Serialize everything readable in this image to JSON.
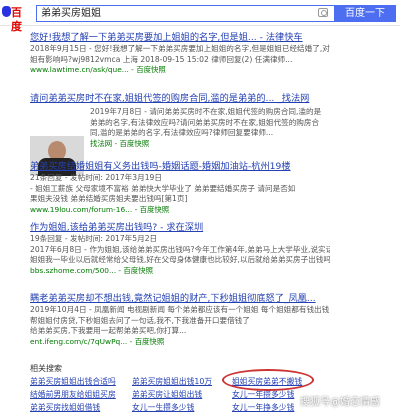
{
  "header": {
    "logo_text": "百度",
    "query": "弟弟买房姐姐",
    "search_button": "百度一下"
  },
  "results": [
    {
      "title": "您好!我想了解一下弟弟买房要加上姐姐的名字,但是姐... - 法律快车",
      "lines": [
        "2018年9月15日 - 您好!我想了解一下弟弟买房要加上姐姐的名字,但是姐姐已经结婚了,对姐",
        "姐有影响吗?wj9812vmca 上海 2018-09-15 15:02 律师回复(2) 任满律师..."
      ],
      "url": "www.lawtime.cn/ask/que... - 百度快照"
    },
    {
      "title": "请问弟弟买房时不在家,姐姐代签的购房合同,滥的是弟弟的... _找法网",
      "lines": [
        "2019年7月8日 - 请问弟弟买房时不在家,姐姐代签的购房合同,滥的是",
        "弟弟的名字,有法律效应吗?请问弟弟买房时不在家,姐姐代签的购房合",
        "同,滥的是弟弟的名字,有法律效应吗?律师回复要律师..."
      ],
      "url": "找法网 - 百度快照"
    },
    {
      "title": "弟弟买房结婚姐姐有义务出钱吗-婚姻话题-婚姻加油站-杭州19楼",
      "lines": [
        "21条回复 - 发帖时间: 2017年3月19日",
        "- 姐姐工薪族 父母家境不富裕 弟弟快大学毕业了 弟弟要结婚买房子 请问是否如",
        "果姐夫没钱 弟弟结婚买房姐夫要出钱吗[第1页]"
      ],
      "url": "www.19lou.com/forum-16... - 百度快照"
    },
    {
      "title": "作为姐姐,该给弟弟买房出钱吗? - 求在深圳",
      "lines": [
        "19条回复 - 发帖时间: 2017年5月2日",
        "2017年6月8日 - 作为姐姐,该给弟弟买房出钱吗?今年工作第4年,弟弟马上大学毕业,说实话",
        "姐姐我一毕业以后就经常给父母钱,好在父母身体健康也比较好,以后就给弟弟买房子出钱吗...",
        "bbs.szhome.com/500... - 百度快照"
      ],
      "url": ""
    },
    {
      "title": "瞒老弟弟买房却不想出钱,竟然记姐姐的财产,下秒姐姐彻底怒了_凤凰...",
      "lines": [
        "2019年10月4日 - 凤凰新闻 电视剧新闻 每个弟弟都应该有一个姐姐 每个姐姐都有钱出钱,",
        "帮姐姐付房贷,下秒姐姐去问了一句话,我不,下我准备开口要借钱了",
        "给弟弟买房,下我要用一起帮弟弟买吧,你打算..."
      ],
      "url": "ent.ifeng.com/c/7qUwPq... - 百度快照"
    }
  ],
  "related": {
    "title": "相关搜索",
    "items": [
      "弟弟买房姐姐出钱合适吗",
      "弟弟买房姐姐出钱10万",
      "姐姐买房弟弟不搬钱",
      "结婚前男朋友给姐姐买房",
      "弟弟买房让姐姐出钱",
      "女儿一年攒多少钱",
      "弟弟买房找姐姐借钱",
      "女儿一生攒多少钱",
      "女儿一年挣多少钱"
    ]
  },
  "watermark": "搜狐号@婚恋情感"
}
